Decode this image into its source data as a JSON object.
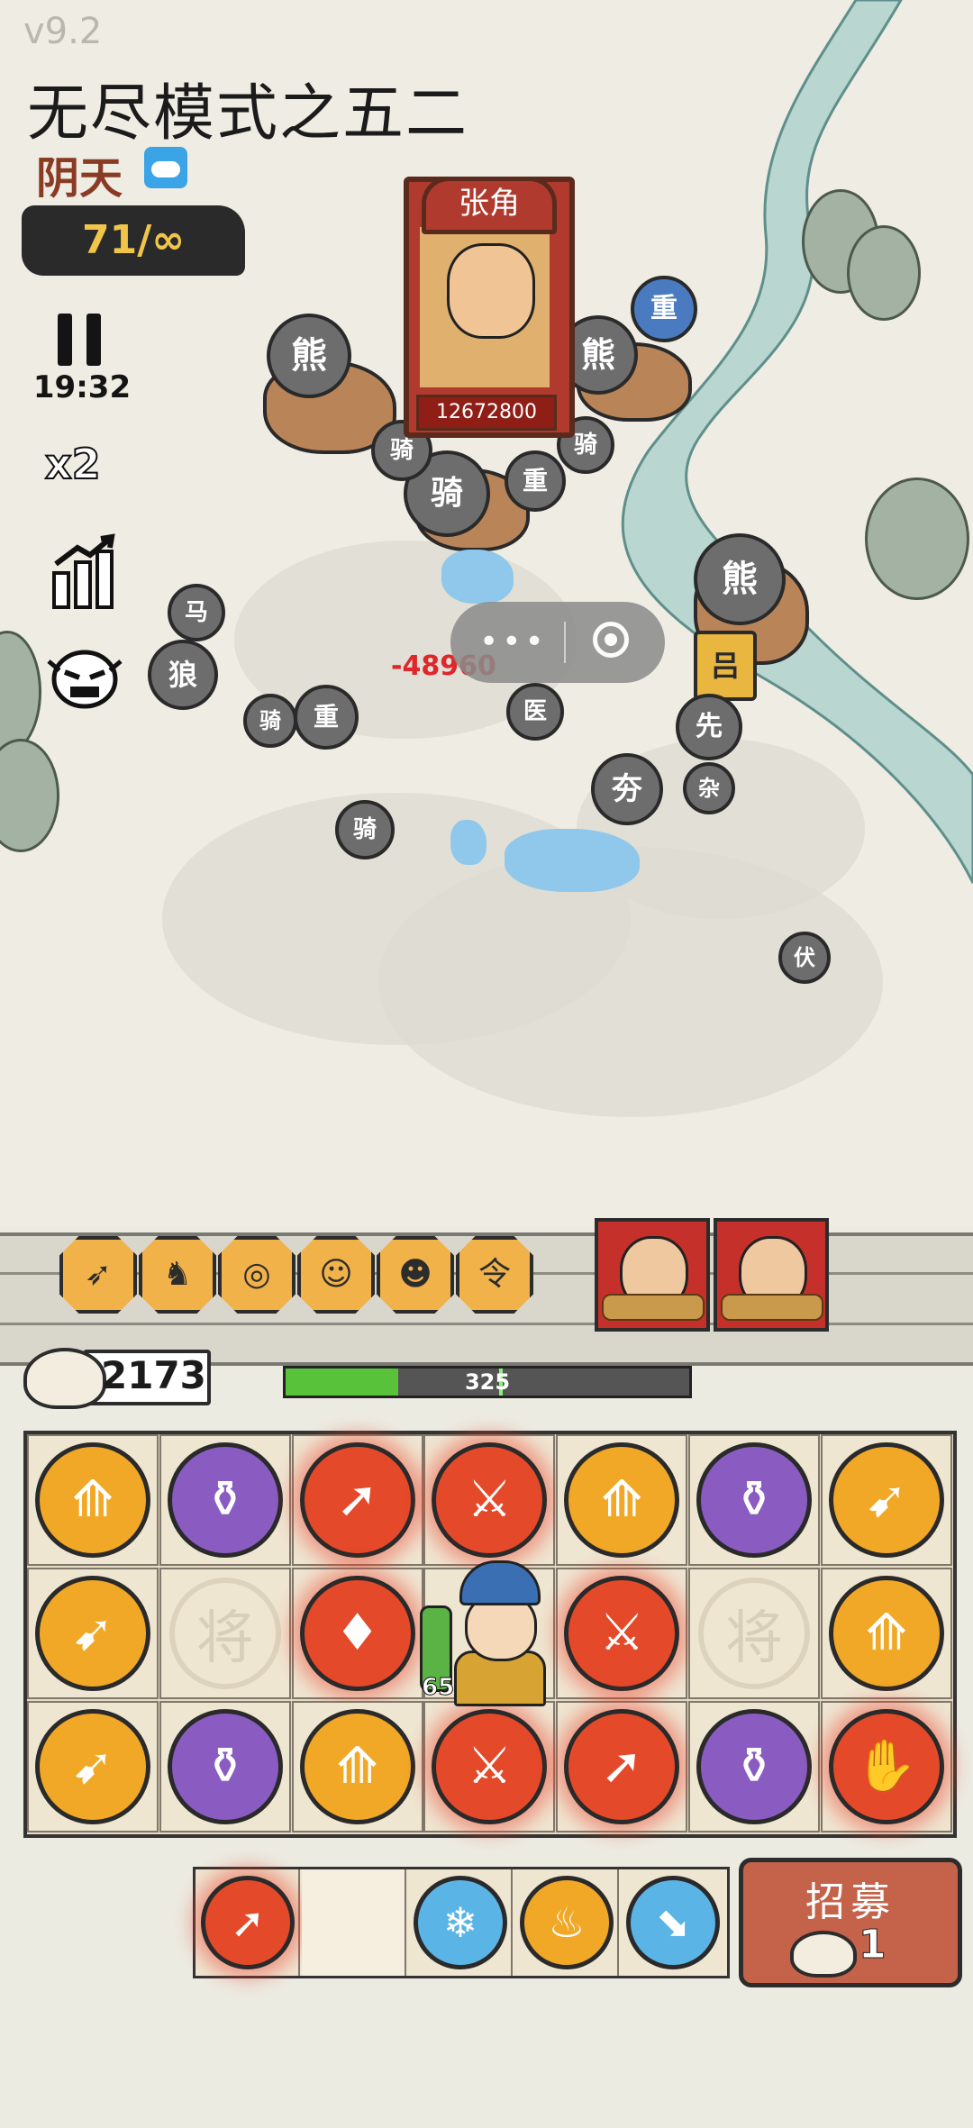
{
  "hud": {
    "version": "v9.2",
    "mode_title": "无尽模式之五二",
    "weather": "阴天",
    "weather_icon": "cloud-icon",
    "wave": "71/∞",
    "timer": "19:32",
    "speed": "x2",
    "pause_icon": "pause-icon",
    "stats_icon": "upgrade-chart-icon",
    "skull_icon": "angry-face-icon"
  },
  "battle": {
    "boss_name": "张角",
    "boss_hp": "12672800",
    "damage_popup": "-48960",
    "unit_labels": [
      "熊",
      "熊",
      "熊",
      "熊",
      "重",
      "重",
      "重",
      "骑",
      "骑",
      "骑",
      "骑",
      "骑",
      "狼",
      "马",
      "吕",
      "医",
      "先",
      "夯",
      "杂",
      "伏",
      "熊"
    ]
  },
  "miniprogram_capsule": {
    "dots": "•••"
  },
  "wall": {
    "buff_icons": [
      "arrows-icon",
      "horse-icon",
      "scroll-icon",
      "general-icon",
      "maiden-icon",
      "token-icon"
    ],
    "buff_glyphs": [
      "➶",
      "♞",
      "◎",
      "☺",
      "☻",
      "令"
    ],
    "captives": [
      "captive-farmer",
      "captive-swordsman"
    ]
  },
  "resources": {
    "buns": "2173",
    "wall_hp": "325",
    "wall_hp_fraction": 0.28
  },
  "board": {
    "rows": [
      [
        "triple-arrow-yellow",
        "jar-purple",
        "arrow-red",
        "sword-red",
        "triple-arrow-yellow",
        "jar-purple",
        "fire-arrow-yellow"
      ],
      [
        "fire-arrow-yellow",
        "general-slot",
        "crystal-red",
        "hero",
        "sword-purple-red",
        "general-slot",
        "triple-arrow-yellow"
      ],
      [
        "fire-arrow-yellow",
        "jar-purple",
        "triple-arrow-yellow",
        "sword-red",
        "arrow-red",
        "jar-purple",
        "hand-red"
      ]
    ],
    "general_slot_label": "将",
    "hero_level": "65"
  },
  "bench": {
    "items": [
      "arrow-red",
      "empty",
      "ice-blue",
      "flame-yellow",
      "boot-blue"
    ]
  },
  "recruit": {
    "label": "招募",
    "cost": "1"
  }
}
